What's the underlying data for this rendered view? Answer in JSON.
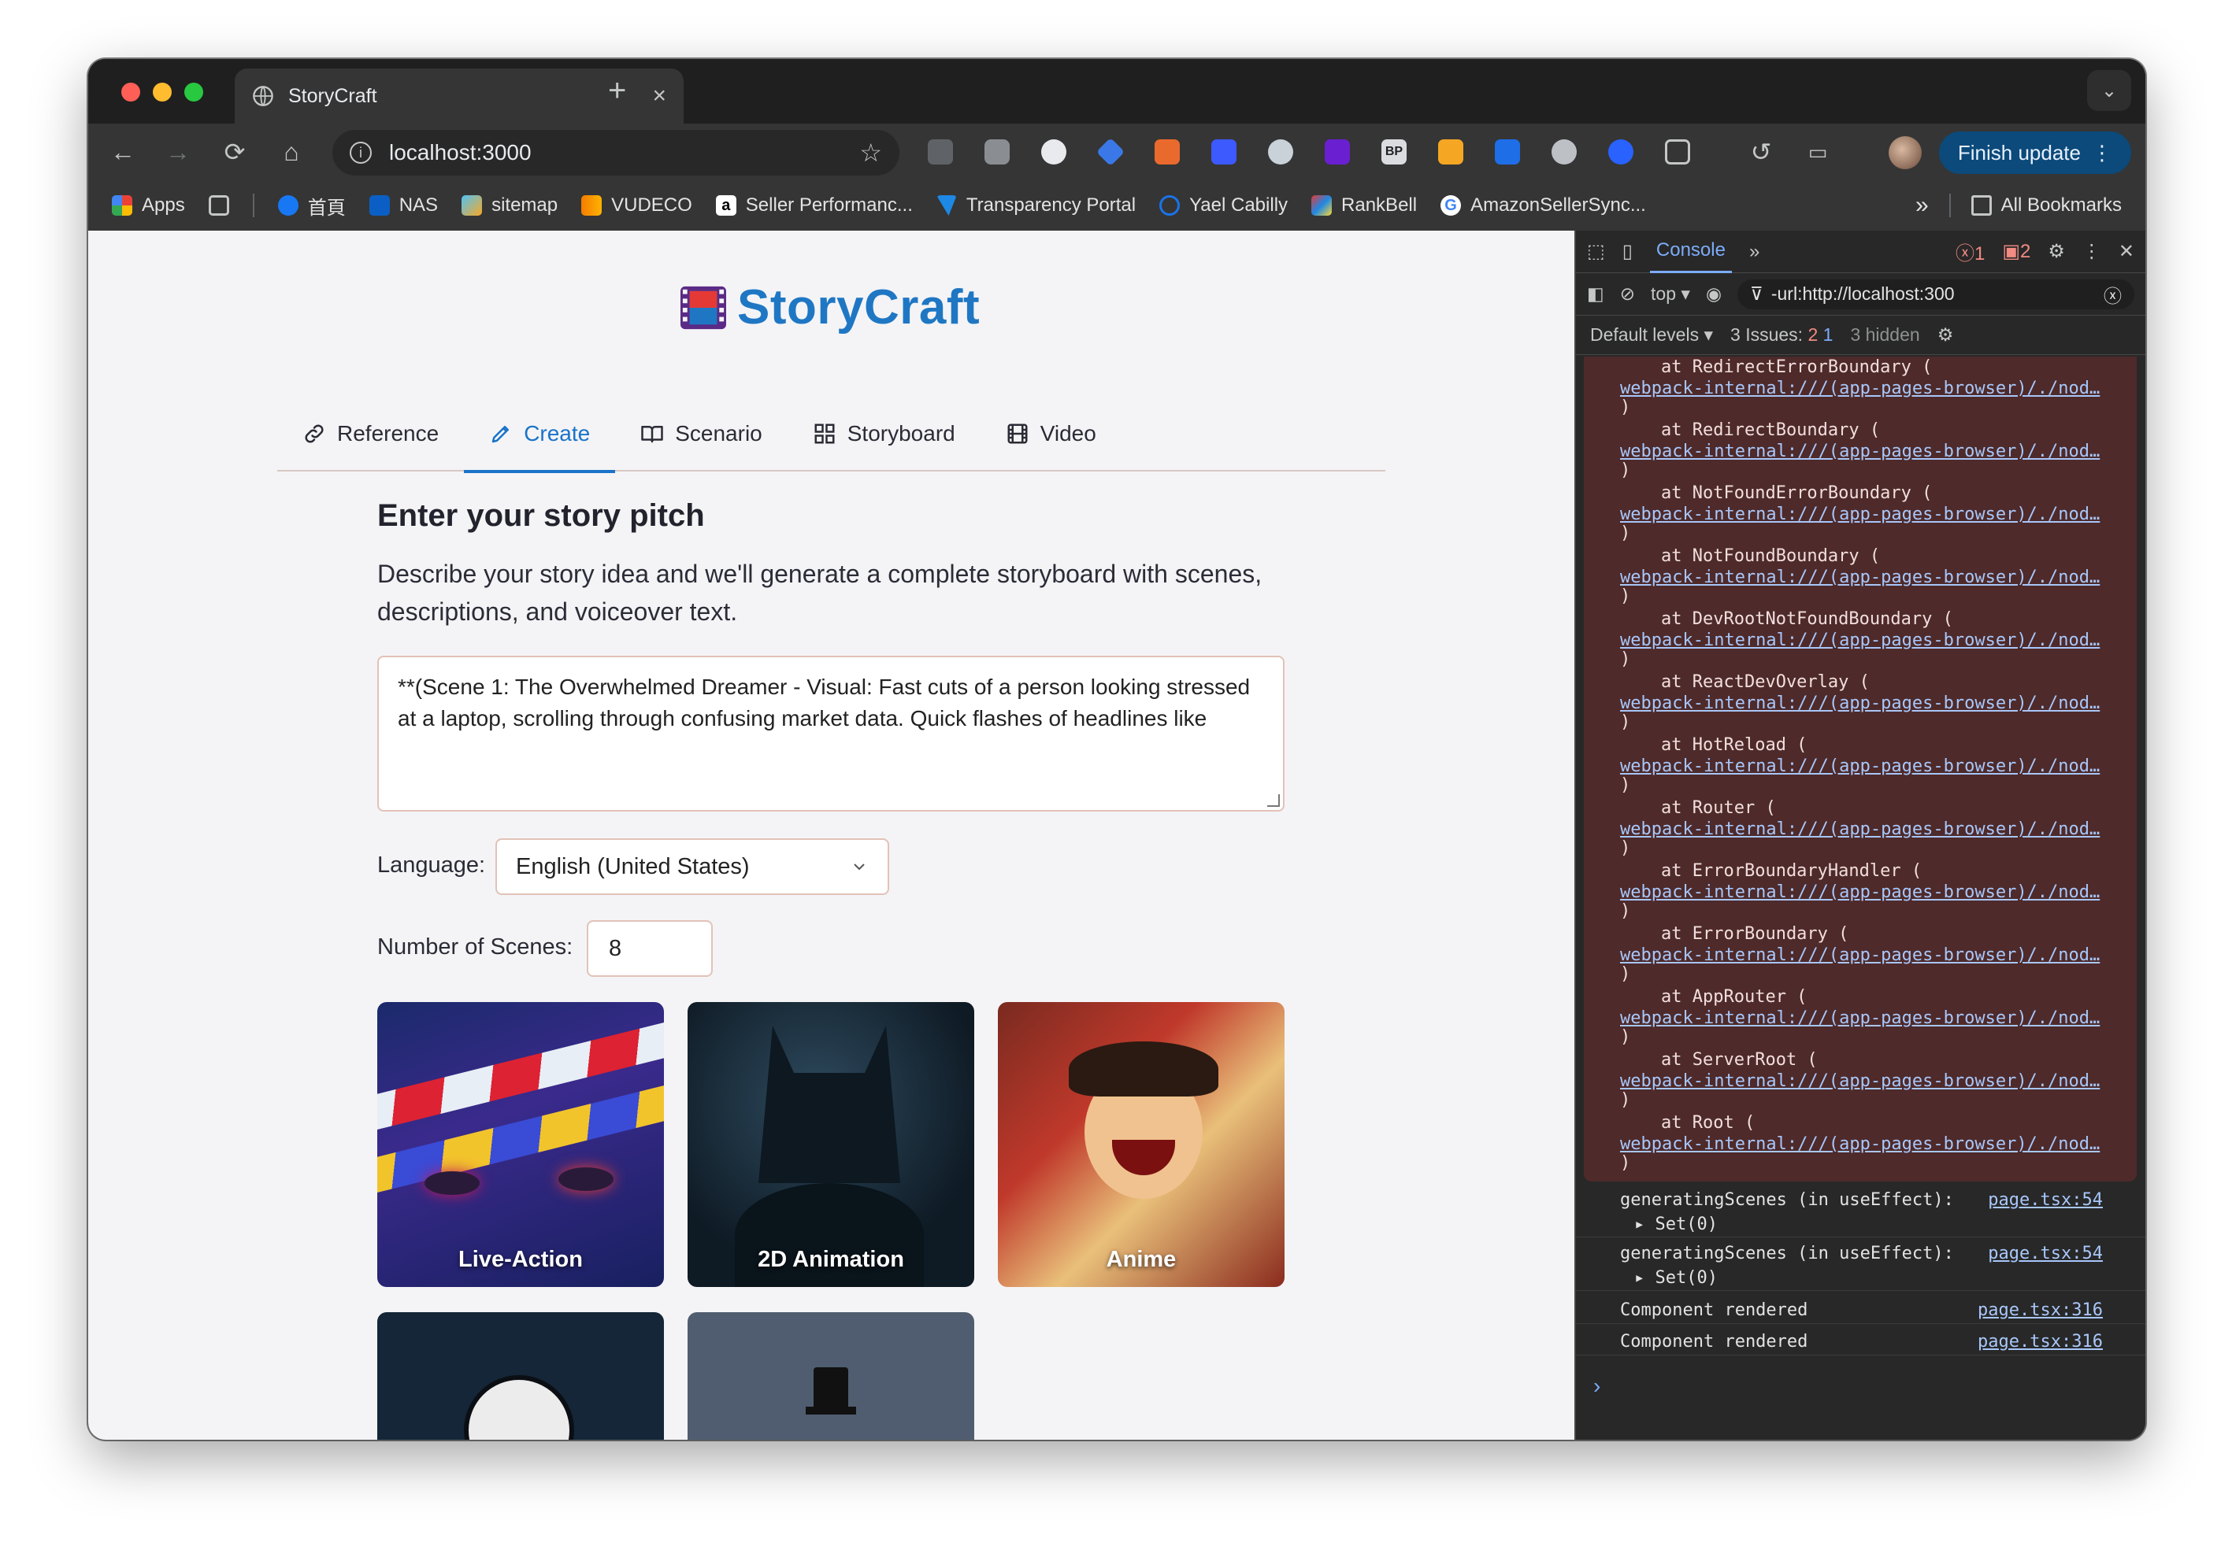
{
  "browser": {
    "tab_title": "StoryCraft",
    "url": "localhost:3000",
    "finish_update_label": "Finish update",
    "bookmarks": [
      {
        "label": "Apps"
      },
      {
        "label": "首頁"
      },
      {
        "label": "NAS"
      },
      {
        "label": "sitemap"
      },
      {
        "label": "VUDECO"
      },
      {
        "label": "Seller Performanc..."
      },
      {
        "label": "Transparency Portal"
      },
      {
        "label": "Yael Cabilly"
      },
      {
        "label": "RankBell"
      },
      {
        "label": "AmazonSellerSync..."
      }
    ],
    "all_bookmarks_label": "All Bookmarks"
  },
  "app": {
    "title": "StoryCraft",
    "tabs": [
      {
        "label": "Reference",
        "icon": "link-icon"
      },
      {
        "label": "Create",
        "icon": "pencil-icon"
      },
      {
        "label": "Scenario",
        "icon": "book-icon"
      },
      {
        "label": "Storyboard",
        "icon": "grid-icon"
      },
      {
        "label": "Video",
        "icon": "film-icon"
      }
    ],
    "heading": "Enter your story pitch",
    "description": "Describe your story idea and we'll generate a complete storyboard with scenes, descriptions, and voiceover text.",
    "pitch_value": "**(Scene 1: The Overwhelmed Dreamer - Visual: Fast cuts of a person looking stressed at a laptop, scrolling through confusing market data. Quick flashes of headlines like",
    "language_label": "Language:",
    "language_value": "English (United States)",
    "scenes_label": "Number of Scenes:",
    "scenes_value": "8",
    "styles": [
      {
        "label": "Live-Action"
      },
      {
        "label": "2D Animation"
      },
      {
        "label": "Anime"
      },
      {
        "label": ""
      },
      {
        "label": ""
      }
    ]
  },
  "devtools": {
    "console_tab": "Console",
    "error_count": "1",
    "warning_count": "2",
    "context": "top",
    "filter_value": "-url:http://localhost:300",
    "levels_label": "Default levels",
    "issues_label": "3 Issues:",
    "issues_errors": "2",
    "issues_info": "1",
    "hidden_label": "3 hidden",
    "trace": [
      {
        "at": "at RedirectErrorBoundary (",
        "link": "webpack-internal:///(app-pages-browser)/./nod…"
      },
      {
        "at": "at RedirectBoundary (",
        "link": "webpack-internal:///(app-pages-browser)/./nod…"
      },
      {
        "at": "at NotFoundErrorBoundary (",
        "link": "webpack-internal:///(app-pages-browser)/./nod…"
      },
      {
        "at": "at NotFoundBoundary (",
        "link": "webpack-internal:///(app-pages-browser)/./nod…"
      },
      {
        "at": "at DevRootNotFoundBoundary (",
        "link": "webpack-internal:///(app-pages-browser)/./nod…"
      },
      {
        "at": "at ReactDevOverlay (",
        "link": "webpack-internal:///(app-pages-browser)/./nod…"
      },
      {
        "at": "at HotReload (",
        "link": "webpack-internal:///(app-pages-browser)/./nod…"
      },
      {
        "at": "at Router (",
        "link": "webpack-internal:///(app-pages-browser)/./nod…"
      },
      {
        "at": "at ErrorBoundaryHandler (",
        "link": "webpack-internal:///(app-pages-browser)/./nod…"
      },
      {
        "at": "at ErrorBoundary (",
        "link": "webpack-internal:///(app-pages-browser)/./nod…"
      },
      {
        "at": "at AppRouter (",
        "link": "webpack-internal:///(app-pages-browser)/./nod…"
      },
      {
        "at": "at ServerRoot (",
        "link": "webpack-internal:///(app-pages-browser)/./nod…"
      },
      {
        "at": "at Root (",
        "link": "webpack-internal:///(app-pages-browser)/./nod…"
      }
    ],
    "trace_close": ")",
    "logs": [
      {
        "text": "generatingScenes (in useEffect):",
        "src": "page.tsx:54",
        "sub": "▸ Set(0)"
      },
      {
        "text": "generatingScenes (in useEffect):",
        "src": "page.tsx:54",
        "sub": "▸ Set(0)"
      },
      {
        "text": "Component rendered",
        "src": "page.tsx:316",
        "sub": ""
      },
      {
        "text": "Component rendered",
        "src": "page.tsx:316",
        "sub": ""
      }
    ],
    "prompt": "›"
  }
}
